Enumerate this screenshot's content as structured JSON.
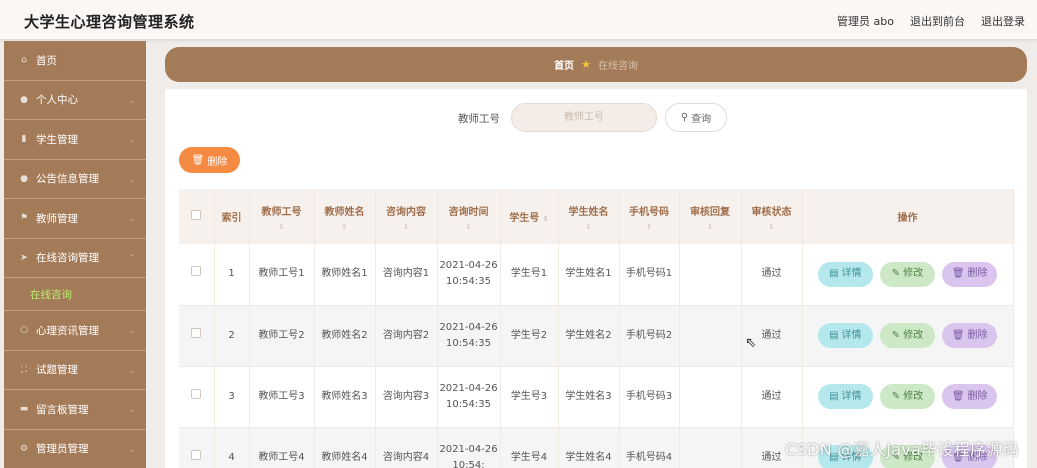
{
  "header": {
    "title": "大学生心理咨询管理系统",
    "links": [
      "管理员 abo",
      "退出到前台",
      "退出登录"
    ]
  },
  "sidebar": {
    "items": [
      {
        "label": "首页",
        "icon": "home-icon"
      },
      {
        "label": "个人中心",
        "icon": "user-icon"
      },
      {
        "label": "学生管理",
        "icon": "chart-icon"
      },
      {
        "label": "公告信息管理",
        "icon": "pin-icon"
      },
      {
        "label": "教师管理",
        "icon": "flag-icon"
      },
      {
        "label": "在线咨询管理",
        "icon": "send-icon"
      },
      {
        "label": "心理资讯管理",
        "icon": "circle-icon"
      },
      {
        "label": "试题管理",
        "icon": "bracket-icon"
      },
      {
        "label": "留言板管理",
        "icon": "bank-icon"
      },
      {
        "label": "管理员管理",
        "icon": "gear-icon"
      }
    ],
    "sub_item": "在线咨询"
  },
  "breadcrumb": {
    "home": "首页",
    "current": "在线咨询"
  },
  "search": {
    "label": "教师工号",
    "placeholder": "教师工号",
    "button": "查询"
  },
  "toolbar": {
    "delete_label": "删除"
  },
  "table": {
    "headers": [
      "索引",
      "教师工号",
      "教师姓名",
      "咨询内容",
      "咨询时间",
      "学生号",
      "学生姓名",
      "手机号码",
      "审核回复",
      "审核状态",
      "操作"
    ],
    "rows": [
      {
        "index": "1",
        "teacher_id": "教师工号1",
        "teacher_name": "教师姓名1",
        "content": "咨询内容1",
        "time": "2021-04-26 10:54:35",
        "student_id": "学生号1",
        "student_name": "学生姓名1",
        "phone": "手机号码1",
        "reply": "",
        "status": "通过"
      },
      {
        "index": "2",
        "teacher_id": "教师工号2",
        "teacher_name": "教师姓名2",
        "content": "咨询内容2",
        "time": "2021-04-26 10:54:35",
        "student_id": "学生号2",
        "student_name": "学生姓名2",
        "phone": "手机号码2",
        "reply": "",
        "status": "通过"
      },
      {
        "index": "3",
        "teacher_id": "教师工号3",
        "teacher_name": "教师姓名3",
        "content": "咨询内容3",
        "time": "2021-04-26 10:54:35",
        "student_id": "学生号3",
        "student_name": "学生姓名3",
        "phone": "手机号码3",
        "reply": "",
        "status": "通过"
      },
      {
        "index": "4",
        "teacher_id": "教师工号4",
        "teacher_name": "教师姓名4",
        "content": "咨询内容4",
        "time": "2021-04-26 10:54:",
        "student_id": "学生号4",
        "student_name": "学生姓名4",
        "phone": "手机号码4",
        "reply": "",
        "status": "通过"
      }
    ],
    "actions": {
      "detail": "详情",
      "edit": "修改",
      "delete": "删除"
    }
  },
  "watermark": "CSDN @嘉人Java毕设程序源码"
}
